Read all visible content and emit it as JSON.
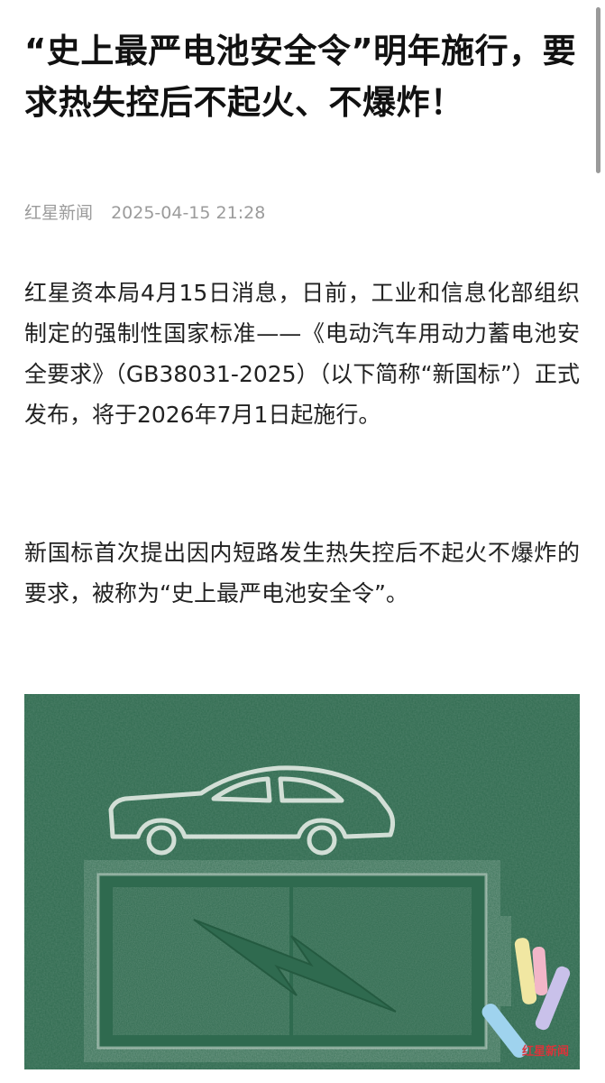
{
  "article": {
    "title": "“史上最严电池安全令”明年施行，要求热失控后不起火、不爆炸！",
    "source": "红星新闻",
    "date": "2025-04-15 21:28",
    "paragraphs": [
      "红星资本局4月15日消息，日前，工业和信息化部组织制定的强制性国家标准——《电动汽车用动力蓄电池安全要求》（GB38031-2025）（以下简称“新国标”）正式发布，将于2026年7月1日起施行。",
      "新国标首次提出因内短路发生热失控后不起火不爆炸的要求，被称为“史上最严电池安全令”。"
    ]
  },
  "figure": {
    "watermark": "红星新闻",
    "colors": {
      "board": "#2f6a4f",
      "chalk": "#dfe8e1",
      "chalk_yellow": "#f1e7a2",
      "chalk_pink": "#f2b6c8",
      "chalk_purple": "#c9c1ea",
      "chalk_blue": "#9fd3ee"
    }
  }
}
